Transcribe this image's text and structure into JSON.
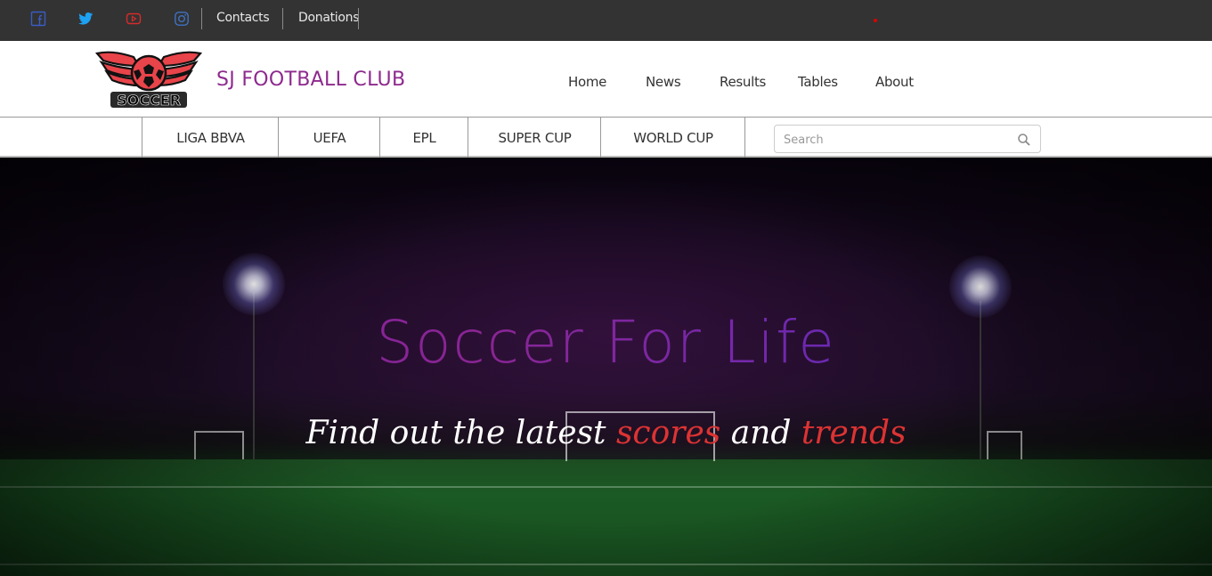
{
  "topbar": {
    "links": [
      "Contacts",
      "Donations"
    ],
    "social_icons": [
      "facebook-icon",
      "twitter-icon",
      "youtube-icon",
      "instagram-icon"
    ]
  },
  "header": {
    "logo_text": "SOCCER",
    "brand": "SJ FOOTBALL CLUB",
    "nav": [
      "Home",
      "News",
      "Results",
      "Tables",
      "About"
    ]
  },
  "categories": [
    "LIGA BBVA",
    "UEFA",
    "EPL",
    "SUPER CUP",
    "WORLD CUP"
  ],
  "search": {
    "placeholder": "Search"
  },
  "hero": {
    "title": "Soccer For Life",
    "subtitle": {
      "part1": "Find out the latest ",
      "accent1": "scores",
      "part2": " and ",
      "accent2": "trends"
    }
  },
  "colors": {
    "topbar_bg": "#333333",
    "brand": "#8e2a8e",
    "accent_red": "#dd3333",
    "title_gradient": [
      "#7b1f9e",
      "#4a2dcf"
    ]
  }
}
